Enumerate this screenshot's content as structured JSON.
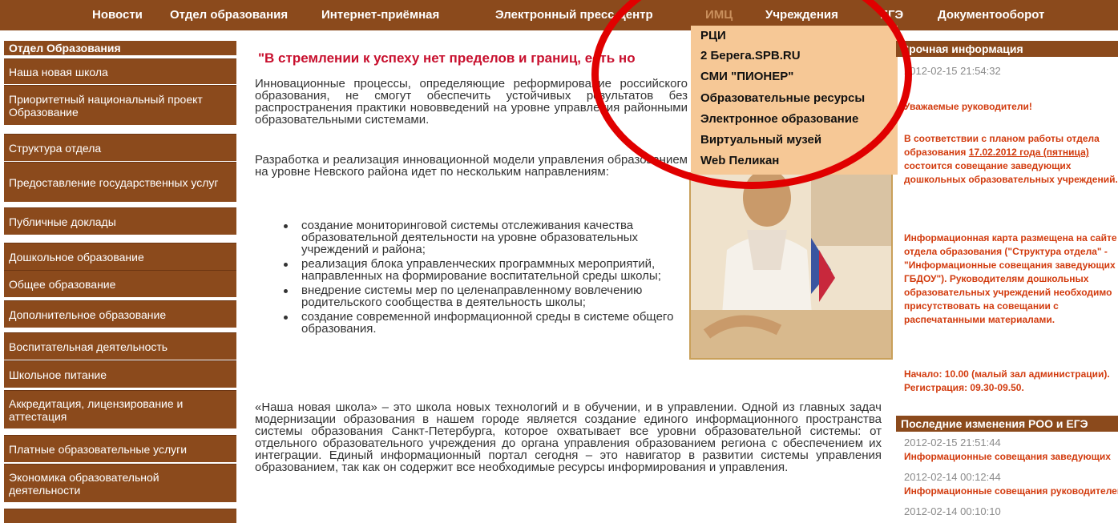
{
  "nav": [
    "Новости",
    "Отдел образования",
    "Интернет-приёмная",
    "Электронный пресс-центр",
    "ИМЦ",
    "Учреждения",
    "ЕГЭ",
    "Документооборот"
  ],
  "dropdown": [
    "РЦИ",
    "2 Берега.SPB.RU",
    "СМИ \"ПИОНЕР\"",
    "Образовательные ресурсы",
    "Электронное образование",
    "Виртуальный музей",
    "Web Пеликан"
  ],
  "sidebar": {
    "header": "Отдел Образования",
    "items": [
      "Наша новая школа",
      "Приоритетный национальный проект Образование",
      "Структура отдела",
      "Предоставление государственных услуг",
      "Публичные доклады",
      "Дошкольное образование",
      "Общее образование",
      "Дополнительное образование",
      "Воспитательная деятельность",
      "Школьное питание",
      "Аккредитация, лицензирование и аттестация",
      "Платные образовательные услуги",
      "Экономика образовательной деятельности"
    ]
  },
  "main": {
    "quote": "\"В стремлении к успеху нет пределов и границ, есть но",
    "p1": "Инновационные процессы, определяющие реформирование российского образования, не смогут обеспечить устойчивых результатов без распространения практики нововведений на уровне управления районными образовательными системами.",
    "p2": "Разработка и реализация инновационной модели управления образованием на уровне Невского района идет по нескольким направлениям:",
    "bullets": [
      "создание мониторинговой системы отслеживания качества образовательной деятельности на уровне образовательных учреждений и района;",
      "реализация блока управленческих программных мероприятий, направленных на формирование воспитательной среды школы;",
      "внедрение системы мер по целенаправленному вовлечению родительского сообщества в деятельность школы;",
      "создание современной информационной среды в системе общего образования."
    ],
    "p3": "«Наша новая школа» – это школа новых технологий и в обучении, и в управлении. Одной из главных задач модернизации образования в нашем городе является создание единого информационного пространства системы образования Санкт-Петербурга, которое охватывает все уровни образовательной системы: от отдельного образовательного учреждения до органа управления образованием региона с обеспечением их интеграции. Единый информационный портал сегодня – это навигатор в развитии системы управления образованием, так как он содержит все необходимые ресурсы информирования и управления."
  },
  "right": {
    "head1": "Срочная информация",
    "date1": "2012-02-15 21:54:32",
    "greeting": "Уважаемые руководители!",
    "msg1a": "В соответствии с планом работы отдела образования",
    "msg1date": "17.02.2012 года (пятница)",
    "msg1b": "состоится совещание заведующих дошкольных образовательных учреждений.",
    "msg2": "Информационная карта размещена на сайте отдела образования (\"Структура отдела\" - \"Информационные совещания заведующих ГБДОУ\"). Руководителям дошкольных образовательных учреждений необходимо присутствовать на совещании с распечатанными материалами.",
    "msg3": "Начало: 10.00 (малый зал администрации). Регистрация: 09.30-09.50.",
    "head2": "Последние изменения РОО и ЕГЭ",
    "updates": [
      {
        "date": "2012-02-15 21:51:44",
        "title": "Информационные совещания заведующих"
      },
      {
        "date": "2012-02-14 00:12:44",
        "title": "Информационные совещания руководителей"
      },
      {
        "date": "2012-02-14 00:10:10",
        "title": ""
      }
    ]
  },
  "colors": {
    "brown": "#8b4a1c",
    "dropdown_bg": "#f6c896",
    "accent_red": "#c8102e",
    "annotation_red": "#e00000",
    "right_text": "#d23b0e"
  }
}
